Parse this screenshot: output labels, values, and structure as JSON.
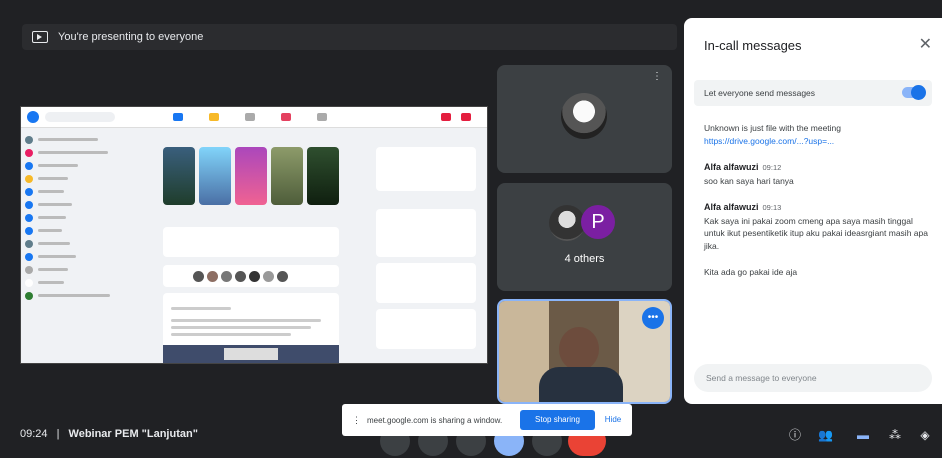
{
  "banner": {
    "text": "You're presenting to everyone",
    "icon": "present-icon"
  },
  "tiles": [
    {
      "name": "",
      "corner": "⋮"
    },
    {
      "name": "4 others",
      "avatar_letter": "P"
    },
    {
      "name": ""
    }
  ],
  "panel": {
    "title": "In-call messages",
    "toggle_label": "Let everyone send messages",
    "messages": [
      {
        "sender": "",
        "time": "",
        "text": "Unknown is just file with the meeting",
        "link": "https://drive.google.com/...?usp=..."
      },
      {
        "sender": "Alfa alfawuzi",
        "time": "09:12",
        "text": "soo kan saya hari tanya"
      },
      {
        "sender": "Alfa alfawuzi",
        "time": "09:13",
        "text": "Kak saya ini pakai zoom cmeng apa saya masih tinggal untuk ikut pesentiketik itup aku pakai ideasrgiant masih apa jika."
      },
      {
        "sender": "",
        "time": "",
        "text": "Kita ada go pakai ide aja"
      }
    ],
    "input_placeholder": "Send a message to everyone"
  },
  "meeting": {
    "time": "09:24",
    "separator": "|",
    "title": "Webinar PEM \"Lanjutan\""
  },
  "toast": {
    "text": "meet.google.com is sharing a window.",
    "stop_label": "Stop sharing",
    "hide_label": "Hide"
  },
  "colors": {
    "accent": "#1a73e8",
    "end_call": "#ea4335",
    "bg": "#202124"
  }
}
